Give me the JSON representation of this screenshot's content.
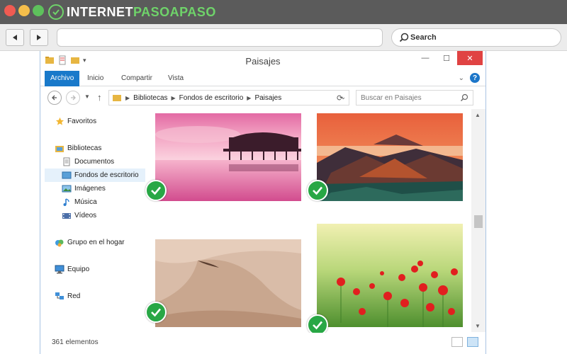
{
  "site": {
    "brand_part1": "INTERNET",
    "brand_part2": "PASOAPASO",
    "search_placeholder": "Search"
  },
  "window": {
    "title": "Paisajes"
  },
  "ribbon": {
    "tabs": [
      "Archivo",
      "Inicio",
      "Compartir",
      "Vista"
    ]
  },
  "address": {
    "crumbs": [
      "Bibliotecas",
      "Fondos de escritorio",
      "Paisajes"
    ],
    "search_placeholder": "Buscar en Paisajes"
  },
  "nav": {
    "favoritos": "Favoritos",
    "bibliotecas": "Bibliotecas",
    "documentos": "Documentos",
    "fondos": "Fondos de escritorio",
    "imagenes": "Imágenes",
    "musica": "Música",
    "videos": "Vídeos",
    "grupo": "Grupo en el hogar",
    "equipo": "Equipo",
    "red": "Red"
  },
  "status": {
    "count": "361 elementos"
  },
  "colors": {
    "accent": "#1979ca",
    "check": "#28a745",
    "close": "#e04343",
    "brand_green": "#6fd36a"
  }
}
